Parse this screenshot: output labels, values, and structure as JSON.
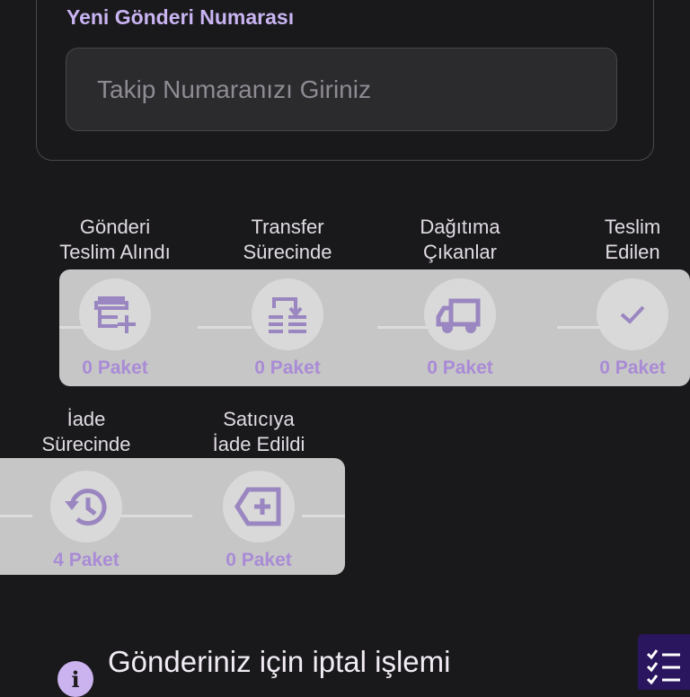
{
  "form": {
    "label": "Yeni Gönderi Numarası",
    "input_value": "",
    "input_placeholder": "Takip Numaranızı Giriniz"
  },
  "steps_row1": [
    {
      "label_line1": "Gönderi",
      "label_line2": "Teslim Alındı",
      "count": "0 Paket",
      "icon": "store-add-icon"
    },
    {
      "label_line1": "Transfer",
      "label_line2": "Sürecinde",
      "count": "0 Paket",
      "icon": "transfer-list-icon"
    },
    {
      "label_line1": "Dağıtıma",
      "label_line2": "Çıkanlar",
      "count": "0 Paket",
      "icon": "truck-icon"
    },
    {
      "label_line1": "Teslim",
      "label_line2": "Edilen",
      "count": "0 Paket",
      "icon": "check-icon"
    }
  ],
  "steps_row2": [
    {
      "label_line1": "İade",
      "label_line2": "Sürecinde",
      "count": "4 Paket",
      "icon": "history-icon"
    },
    {
      "label_line1": "Satıcıya",
      "label_line2": "İade Edildi",
      "count": "0 Paket",
      "icon": "backspace-add-icon"
    }
  ],
  "notice": {
    "icon_text": "i",
    "text": "Gönderiniz için iptal işlemi"
  },
  "colors": {
    "accent": "#c9b4f2",
    "count_text": "#a98bd6",
    "icon": "#9a86c0",
    "fab_bg": "#2a165e"
  }
}
